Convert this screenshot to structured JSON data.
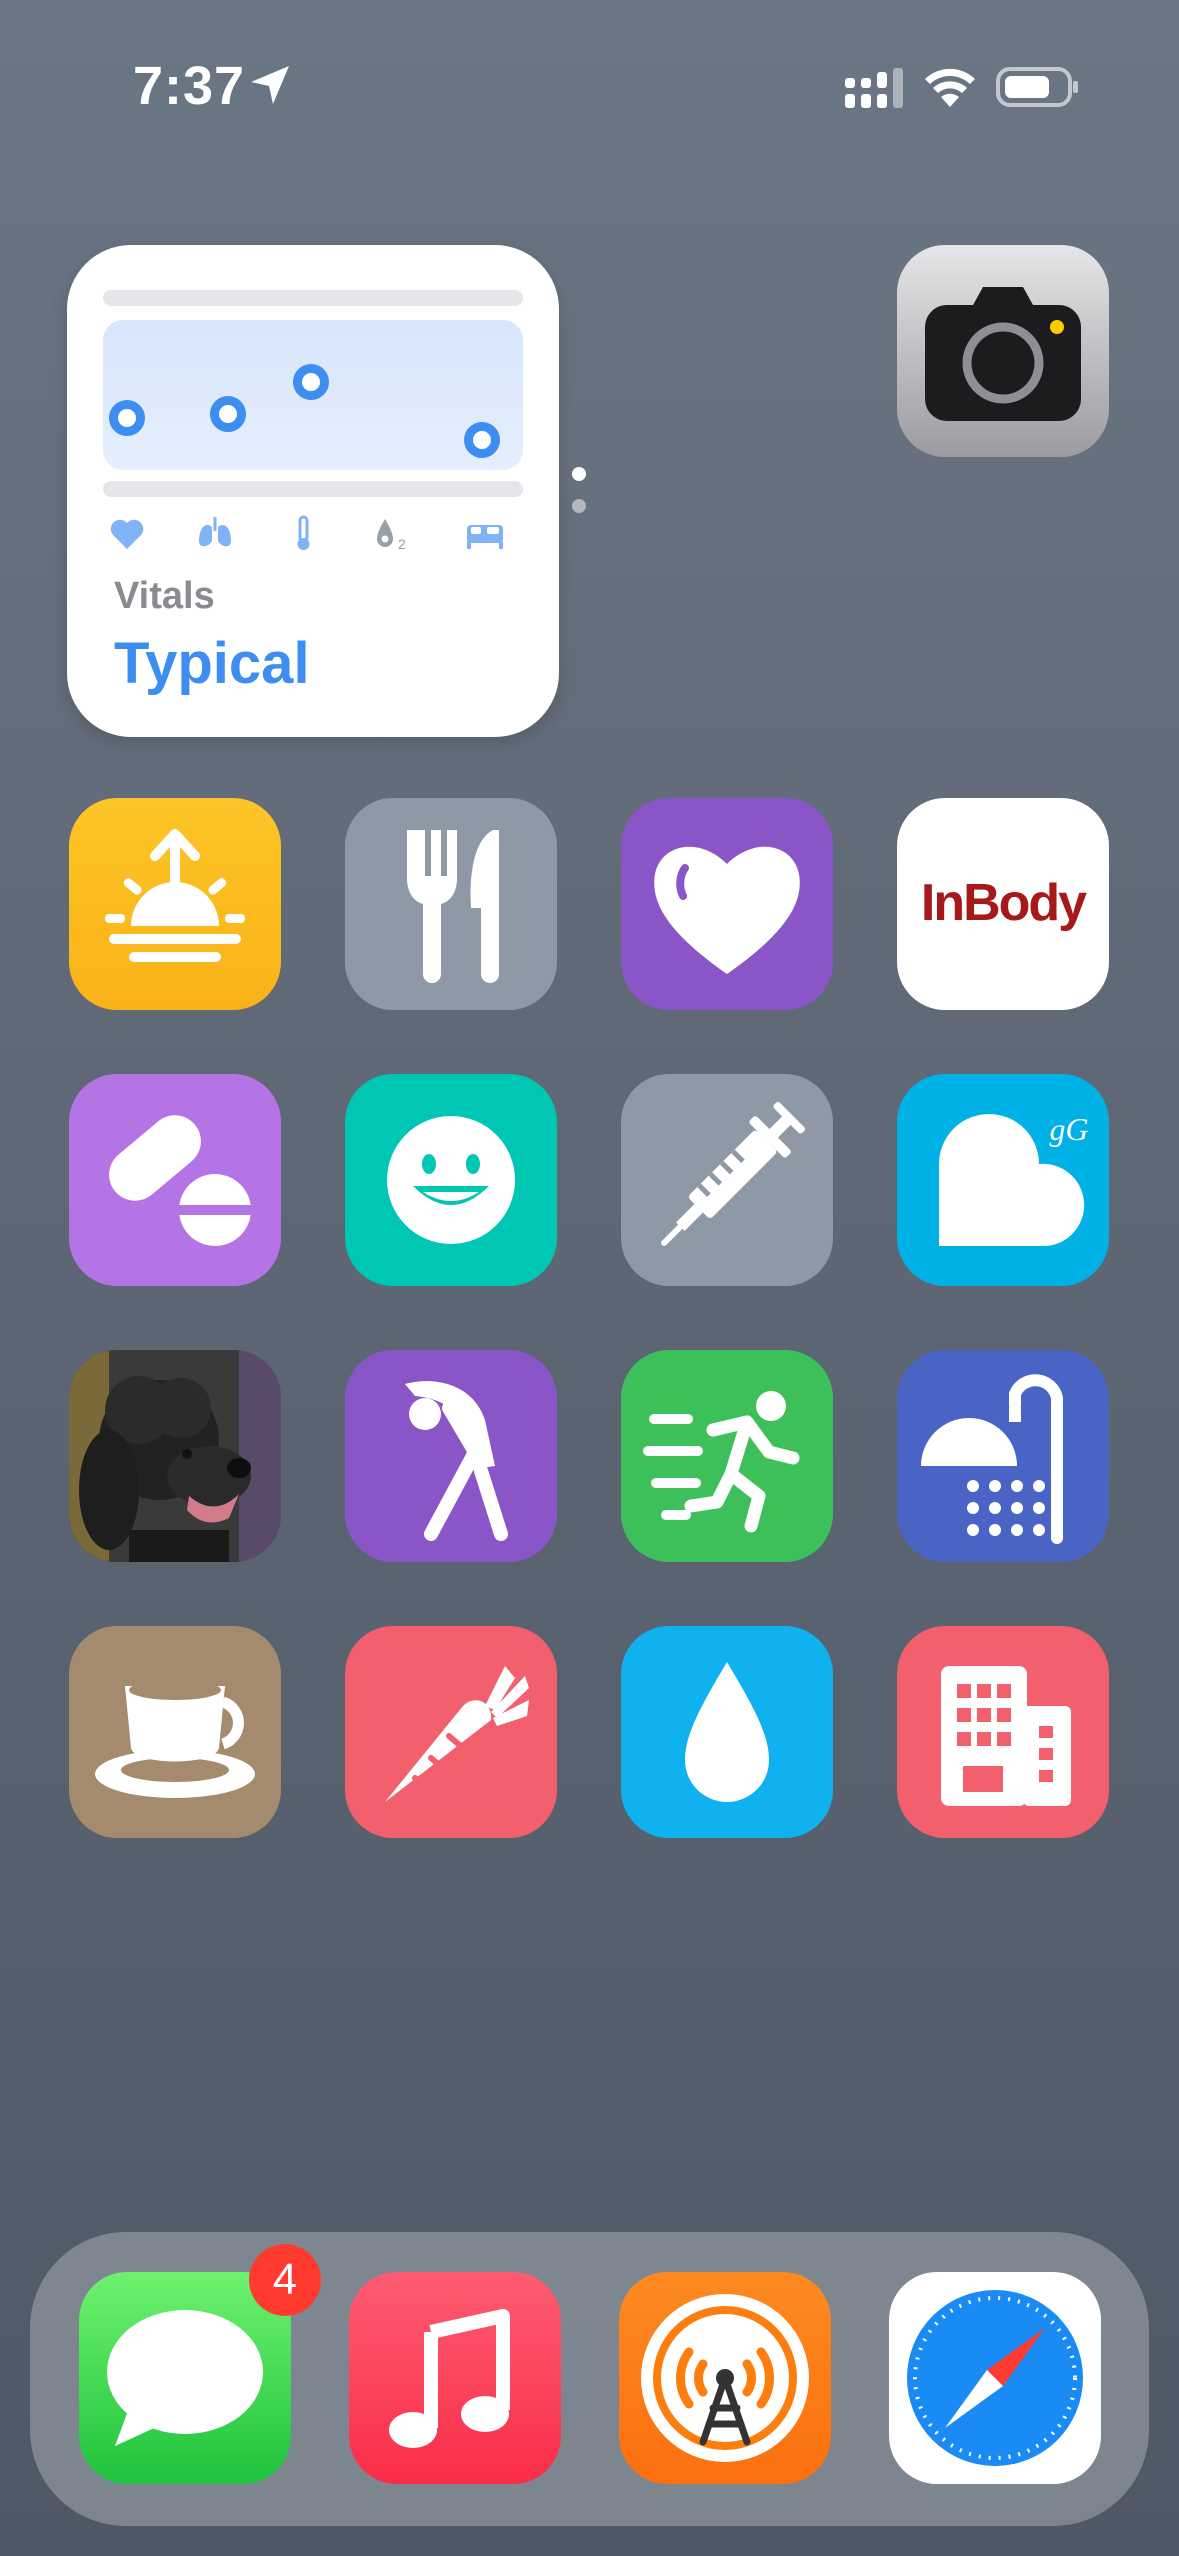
{
  "status_bar": {
    "time": "7:37",
    "icons": [
      "location-arrow-icon",
      "cellular-signal-icon",
      "wifi-icon",
      "battery-icon"
    ]
  },
  "widget": {
    "name": "Vitals",
    "value": "Typical",
    "accent_color": "#3d8ef0",
    "metric_icons": [
      "heart-icon",
      "lungs-icon",
      "thermometer-icon",
      "blood-oxygen-icon",
      "bed-icon"
    ],
    "o2_subscript": "2"
  },
  "apps": [
    {
      "icon": "sunrise-icon",
      "color": "#fbbc1c"
    },
    {
      "icon": "fork-knife-icon",
      "color": "#8f99a5"
    },
    {
      "icon": "heart-icon",
      "color": "#8a55c7"
    },
    {
      "icon": "inbody-logo",
      "color": "#ffffff",
      "logo_text": "InBody"
    },
    {
      "icon": "pills-icon",
      "color": "#b574e6"
    },
    {
      "icon": "smiley-face-icon",
      "color": "#00c7b3"
    },
    {
      "icon": "syringe-icon",
      "color": "#8f99a5"
    },
    {
      "icon": "gentler-heart-icon",
      "color": "#00b1e6",
      "logo_text": "gG"
    },
    {
      "icon": "dog-photo-icon",
      "color": "#2b2b2b"
    },
    {
      "icon": "stretching-figure-icon",
      "color": "#8a55c7"
    },
    {
      "icon": "running-figure-icon",
      "color": "#3dbf5a"
    },
    {
      "icon": "shower-icon",
      "color": "#4a64c6"
    },
    {
      "icon": "coffee-cup-icon",
      "color": "#a58b6e"
    },
    {
      "icon": "carrot-icon",
      "color": "#f2606d"
    },
    {
      "icon": "water-drop-icon",
      "color": "#0fb1ef"
    },
    {
      "icon": "building-icon",
      "color": "#f2606d"
    }
  ],
  "dock": {
    "apps": [
      {
        "icon": "messages-icon",
        "color": "#35c94f"
      },
      {
        "icon": "music-note-icon",
        "color": "#fc3a55"
      },
      {
        "icon": "overcast-icon",
        "color": "#fc7e0f"
      },
      {
        "icon": "safari-compass-icon",
        "color": "#ffffff"
      }
    ],
    "messages_badge": "4"
  },
  "page_indicator": {
    "pages": 2,
    "current": 1
  }
}
